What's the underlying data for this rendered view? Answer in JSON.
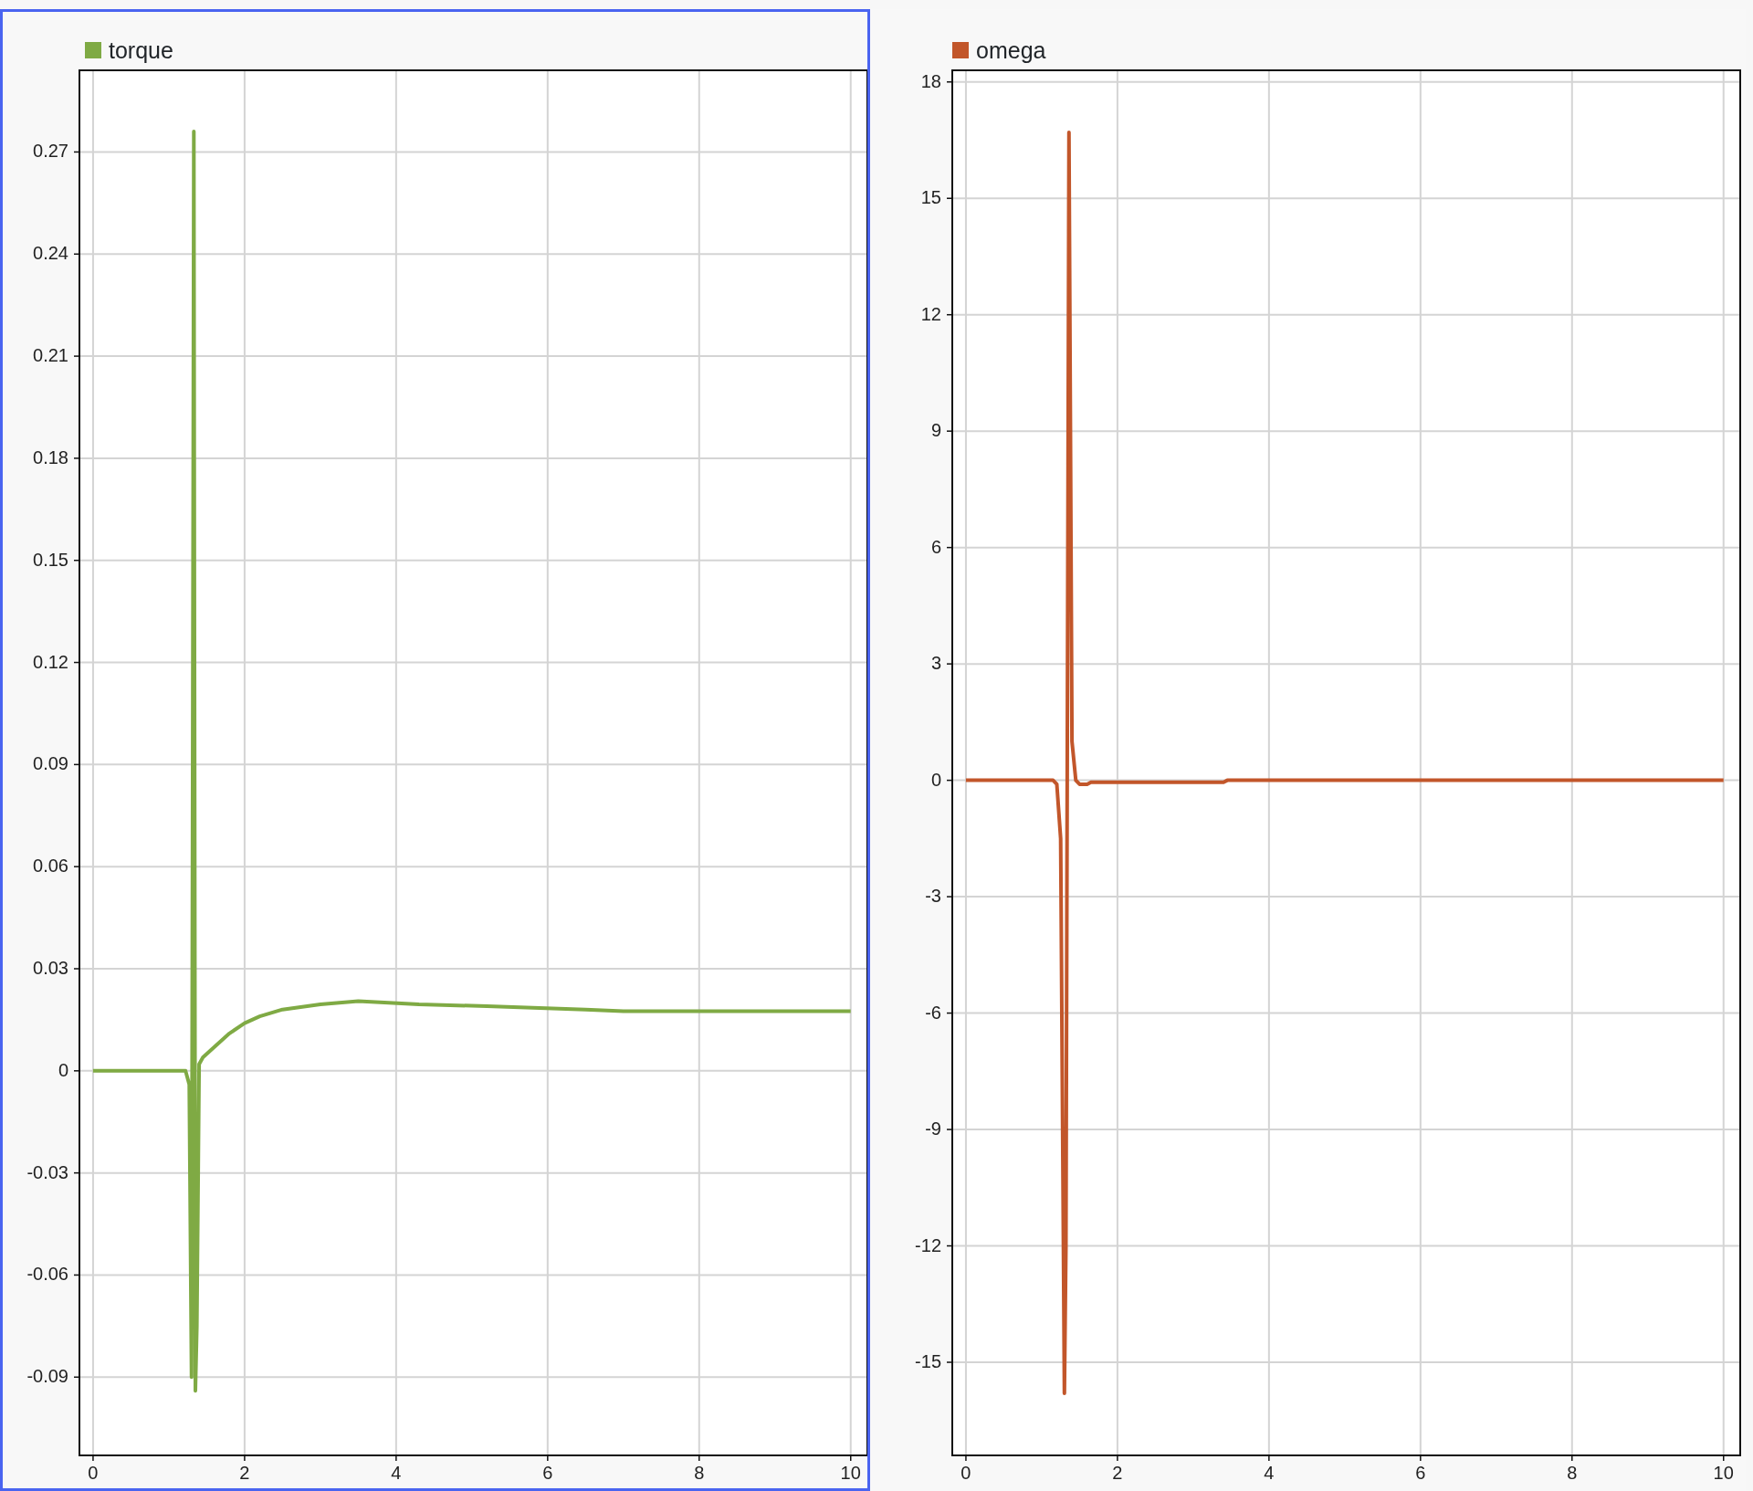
{
  "plots": [
    {
      "selected": true,
      "chart_data": {
        "type": "line",
        "x": [
          0,
          1.22,
          1.27,
          1.3,
          1.33,
          1.35,
          1.37,
          1.4,
          1.45,
          1.6,
          1.8,
          2.0,
          2.2,
          2.5,
          3.0,
          3.5,
          4.3,
          5.2,
          6.5,
          7.0,
          10
        ],
        "series": [
          {
            "name": "torque",
            "color": "#7faa44",
            "values": [
              0,
              0,
              -0.004,
              -0.09,
              0.276,
              -0.094,
              -0.075,
              0.002,
              0.004,
              0.007,
              0.011,
              0.014,
              0.016,
              0.018,
              0.0195,
              0.0205,
              0.0195,
              0.019,
              0.018,
              0.0175,
              0.0175
            ]
          }
        ],
        "grid": true,
        "xlim": [
          -0.18,
          10.22
        ],
        "ylim": [
          -0.113,
          0.294
        ],
        "xticks": [
          0,
          2,
          4,
          6,
          8,
          10
        ],
        "yticks": [
          {
            "value": -0.09,
            "label": "-0.09"
          },
          {
            "value": -0.06,
            "label": "-0.06"
          },
          {
            "value": -0.03,
            "label": "-0.03"
          },
          {
            "value": 0,
            "label": "0"
          },
          {
            "value": 0.03,
            "label": "0.03"
          },
          {
            "value": 0.06,
            "label": "0.06"
          },
          {
            "value": 0.09,
            "label": "0.09"
          },
          {
            "value": 0.12,
            "label": "0.12"
          },
          {
            "value": 0.15,
            "label": "0.15"
          },
          {
            "value": 0.18,
            "label": "0.18"
          },
          {
            "value": 0.21,
            "label": "0.21"
          },
          {
            "value": 0.24,
            "label": "0.24"
          },
          {
            "value": 0.27,
            "label": "0.27"
          }
        ]
      }
    },
    {
      "selected": false,
      "chart_data": {
        "type": "line",
        "x": [
          0,
          1.15,
          1.2,
          1.25,
          1.3,
          1.32,
          1.36,
          1.4,
          1.45,
          1.5,
          1.6,
          1.65,
          2,
          3.4,
          3.45,
          10
        ],
        "series": [
          {
            "name": "omega",
            "color": "#c2562a",
            "values": [
              0,
              0,
              -0.1,
              -1.5,
              -15.8,
              -12,
              16.7,
              1,
              0,
              -0.1,
              -0.1,
              -0.05,
              -0.05,
              -0.05,
              0,
              0
            ]
          }
        ],
        "grid": true,
        "xlim": [
          -0.18,
          10.22
        ],
        "ylim": [
          -17.4,
          18.3
        ],
        "xticks": [
          0,
          2,
          4,
          6,
          8,
          10
        ],
        "yticks": [
          {
            "value": -15,
            "label": "-15"
          },
          {
            "value": -12,
            "label": "-12"
          },
          {
            "value": -9,
            "label": "-9"
          },
          {
            "value": -6,
            "label": "-6"
          },
          {
            "value": -3,
            "label": "-3"
          },
          {
            "value": 0,
            "label": "0"
          },
          {
            "value": 3,
            "label": "3"
          },
          {
            "value": 6,
            "label": "6"
          },
          {
            "value": 9,
            "label": "9"
          },
          {
            "value": 12,
            "label": "12"
          },
          {
            "value": 15,
            "label": "15"
          },
          {
            "value": 18,
            "label": "18"
          }
        ]
      }
    }
  ]
}
